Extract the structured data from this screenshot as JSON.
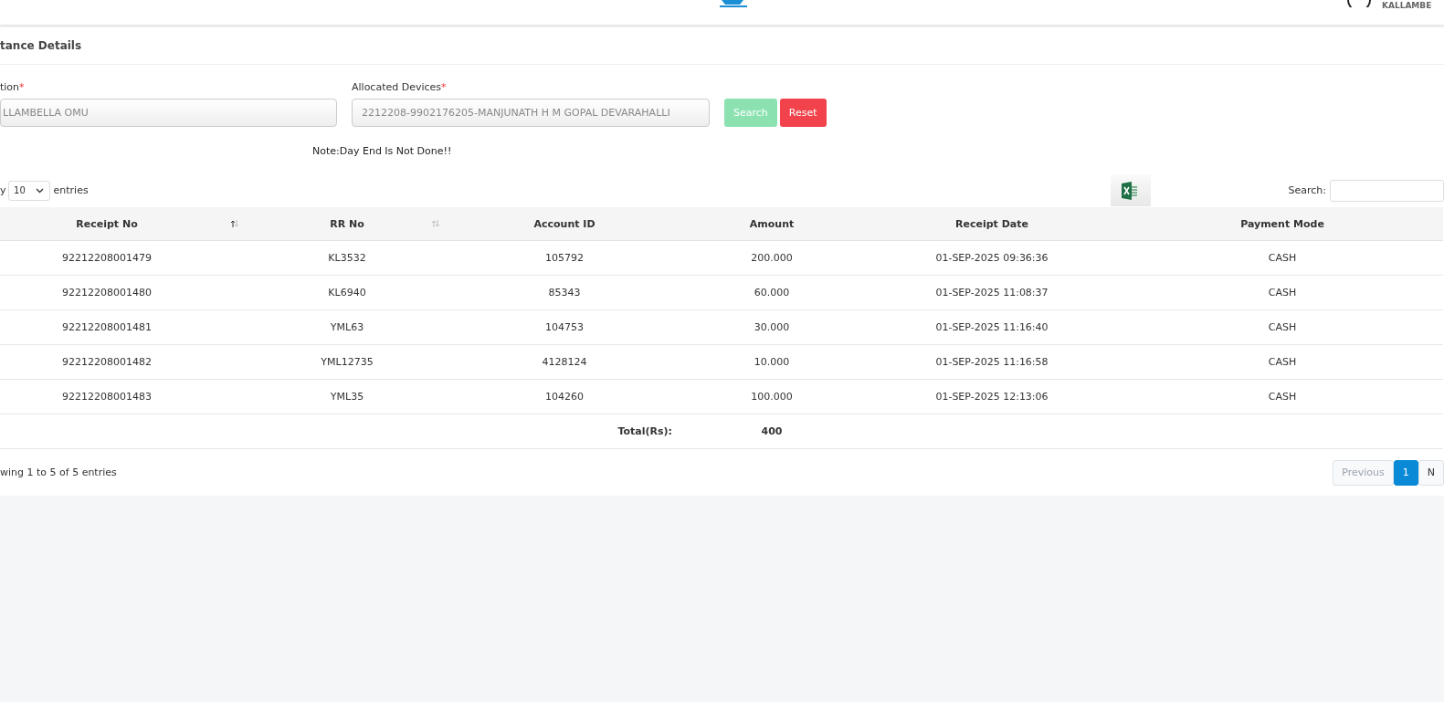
{
  "header": {
    "user": "KALLAMBE"
  },
  "card": {
    "title": "tance Details"
  },
  "form": {
    "fields": [
      {
        "label": "tion",
        "required_mark": "*",
        "value": "LLAMBELLA OMU"
      },
      {
        "label": "Allocated Devices",
        "required_mark": "*",
        "value": "2212208-9902176205-MANJUNATH H M GOPAL DEVARAHALLI"
      }
    ],
    "buttons": [
      {
        "label": "Search",
        "kind": "primary",
        "disabled": true
      },
      {
        "label": "Reset",
        "kind": "danger",
        "disabled": false
      }
    ],
    "note": "Note:Day End Is Not Done!!"
  },
  "length": {
    "prefix": "y",
    "value": "10",
    "suffix": "entries"
  },
  "search": {
    "label": "Search:"
  },
  "table": {
    "columns": [
      {
        "label": "Receipt No",
        "sortable": true,
        "sorted": true
      },
      {
        "label": "RR No",
        "sortable": true,
        "sorted": false
      },
      {
        "label": "Account ID",
        "sortable": false
      },
      {
        "label": "Amount",
        "sortable": false
      },
      {
        "label": "Receipt Date",
        "sortable": false
      },
      {
        "label": "Payment Mode",
        "sortable": false
      }
    ],
    "rows": [
      [
        "92212208001479",
        "KL3532",
        "105792",
        "200.000",
        "01-SEP-2025 09:36:36",
        "CASH"
      ],
      [
        "92212208001480",
        "KL6940",
        "85343",
        "60.000",
        "01-SEP-2025 11:08:37",
        "CASH"
      ],
      [
        "92212208001481",
        "YML63",
        "104753",
        "30.000",
        "01-SEP-2025 11:16:40",
        "CASH"
      ],
      [
        "92212208001482",
        "YML12735",
        "4128124",
        "10.000",
        "01-SEP-2025 11:16:58",
        "CASH"
      ],
      [
        "92212208001483",
        "YML35",
        "104260",
        "100.000",
        "01-SEP-2025 12:13:06",
        "CASH"
      ]
    ],
    "total": {
      "label": "Total(Rs):",
      "value": "400"
    }
  },
  "info": "wing 1 to 5 of 5 entries",
  "pagination": [
    {
      "label": "Previous",
      "selected": false,
      "disabled": true
    },
    {
      "label": "1",
      "selected": true,
      "disabled": false
    },
    {
      "label": "N",
      "selected": false,
      "disabled": false
    }
  ]
}
